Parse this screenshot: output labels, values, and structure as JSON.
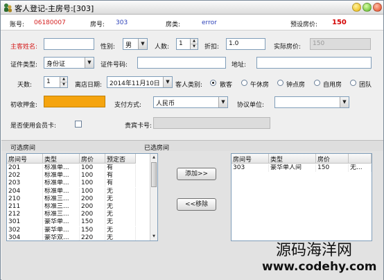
{
  "window": {
    "title": "客人登记-主房号:[303]"
  },
  "summary": {
    "account_label": "账号:",
    "account_value": "06180007",
    "room_label": "房号:",
    "room_value": "303",
    "roomtype_label": "房类:",
    "roomtype_value": "error",
    "preset_price_label": "预设房价:",
    "preset_price_value": "150"
  },
  "form": {
    "guest_name_label": "主客姓名:",
    "guest_name_value": "",
    "gender_label": "性别:",
    "gender_value": "男",
    "people_label": "人数:",
    "people_value": "1",
    "discount_label": "折扣:",
    "discount_value": "1.0",
    "actual_price_label": "实际房价:",
    "actual_price_value": "150",
    "id_type_label": "证件类型:",
    "id_type_value": "身份证",
    "id_number_label": "证件号码:",
    "id_number_value": "",
    "address_label": "地址:",
    "address_value": "",
    "days_label": "天数:",
    "days_value": "1",
    "leave_date_label": "离店日期:",
    "leave_date_value": "2014年11月10日",
    "guest_type_label": "客人类别:",
    "guest_types": [
      "散客",
      "午休房",
      "钟点房",
      "自用房",
      "团队"
    ],
    "deposit_label": "初收押金:",
    "deposit_value": "",
    "payment_label": "支付方式:",
    "payment_value": "人民币",
    "agreement_label": "协议单位:",
    "agreement_value": "",
    "member_card_label": "是否使用会员卡:",
    "vip_card_label": "贵宾卡号:",
    "vip_card_value": ""
  },
  "sections": {
    "available_label": "可选房间",
    "selected_label": "已选房间"
  },
  "available_table": {
    "headers": [
      "房间号",
      "类型",
      "房价",
      "预定否"
    ],
    "rows": [
      [
        "201",
        "标准单...",
        "100",
        "有"
      ],
      [
        "202",
        "标准单...",
        "100",
        "有"
      ],
      [
        "203",
        "标准单...",
        "100",
        "有"
      ],
      [
        "204",
        "标准单...",
        "100",
        "无"
      ],
      [
        "210",
        "标准三...",
        "200",
        "无"
      ],
      [
        "211",
        "标准三...",
        "200",
        "无"
      ],
      [
        "212",
        "标准三...",
        "200",
        "无"
      ],
      [
        "301",
        "豪华单...",
        "150",
        "无"
      ],
      [
        "302",
        "豪华单...",
        "150",
        "无"
      ],
      [
        "304",
        "豪华双...",
        "220",
        "无"
      ]
    ]
  },
  "selected_table": {
    "headers": [
      "房间号",
      "类型",
      "房价",
      ""
    ],
    "rows": [
      [
        "303",
        "豪华单人间",
        "150",
        "无..."
      ]
    ]
  },
  "buttons": {
    "add": "添加>>",
    "remove": "<<移除"
  },
  "watermark": {
    "line1": "源码海洋网",
    "line2": "www.codehy.com"
  }
}
